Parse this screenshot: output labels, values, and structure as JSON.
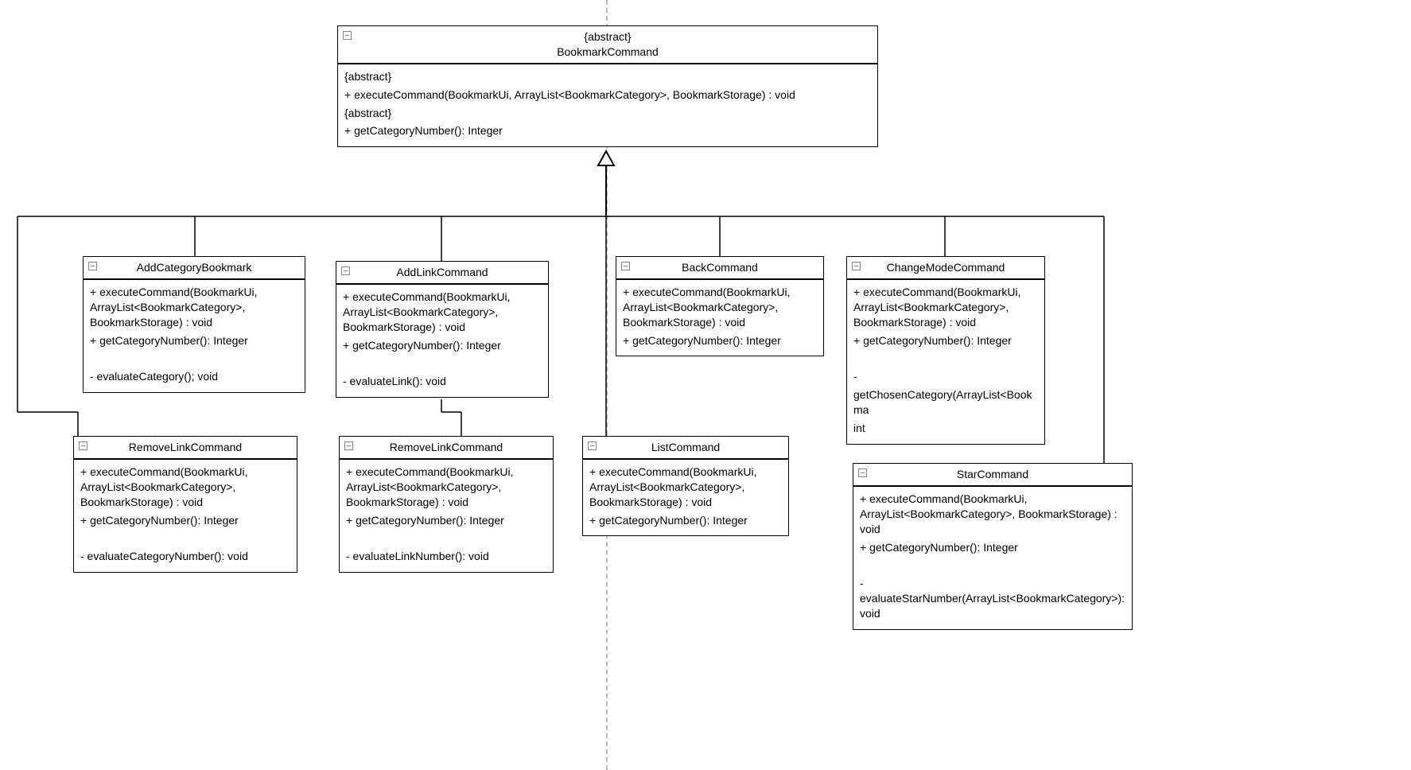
{
  "parent": {
    "stereotype": "{abstract}",
    "name": "BookmarkCommand",
    "body": [
      "{abstract}",
      "+ executeCommand(BookmarkUi, ArrayList<BookmarkCategory>, BookmarkStorage) : void",
      "{abstract}",
      "+ getCategoryNumber(): Integer"
    ]
  },
  "classes": [
    {
      "id": "addcat",
      "name": "AddCategoryBookmark",
      "body": [
        "+ executeCommand(BookmarkUi, ArrayList<BookmarkCategory>, BookmarkStorage) : void",
        "+ getCategoryNumber(): Integer",
        "",
        "- evaluateCategory(); void"
      ]
    },
    {
      "id": "addlink",
      "name": "AddLinkCommand",
      "body": [
        "+ executeCommand(BookmarkUi, ArrayList<BookmarkCategory>, BookmarkStorage) : void",
        "+ getCategoryNumber(): Integer",
        "",
        "- evaluateLink(): void"
      ]
    },
    {
      "id": "back",
      "name": "BackCommand",
      "body": [
        "+ executeCommand(BookmarkUi, ArrayList<BookmarkCategory>, BookmarkStorage) : void",
        "+ getCategoryNumber(): Integer"
      ]
    },
    {
      "id": "chmode",
      "name": "ChangeModeCommand",
      "body": [
        "+ executeCommand(BookmarkUi, ArrayList<BookmarkCategory>, BookmarkStorage) : void",
        "+ getCategoryNumber(): Integer",
        "",
        "-",
        "getChosenCategory(ArrayList<Bookma",
        "int"
      ]
    },
    {
      "id": "rmlink1",
      "name": "RemoveLinkCommand",
      "body": [
        "+ executeCommand(BookmarkUi, ArrayList<BookmarkCategory>, BookmarkStorage) : void",
        "+ getCategoryNumber(): Integer",
        "",
        "- evaluateCategoryNumber(): void"
      ]
    },
    {
      "id": "rmlink2",
      "name": "RemoveLinkCommand",
      "body": [
        "+ executeCommand(BookmarkUi, ArrayList<BookmarkCategory>, BookmarkStorage) : void",
        "+ getCategoryNumber(): Integer",
        "",
        "- evaluateLinkNumber(): void"
      ]
    },
    {
      "id": "list",
      "name": "ListCommand",
      "body": [
        "+ executeCommand(BookmarkUi, ArrayList<BookmarkCategory>, BookmarkStorage) : void",
        "+ getCategoryNumber(): Integer"
      ]
    },
    {
      "id": "star",
      "name": "StarCommand",
      "body": [
        "+ executeCommand(BookmarkUi, ArrayList<BookmarkCategory>, BookmarkStorage) : void",
        "+ getCategoryNumber(): Integer",
        "",
        "- evaluateStarNumber(ArrayList<BookmarkCategory>): void"
      ]
    }
  ]
}
